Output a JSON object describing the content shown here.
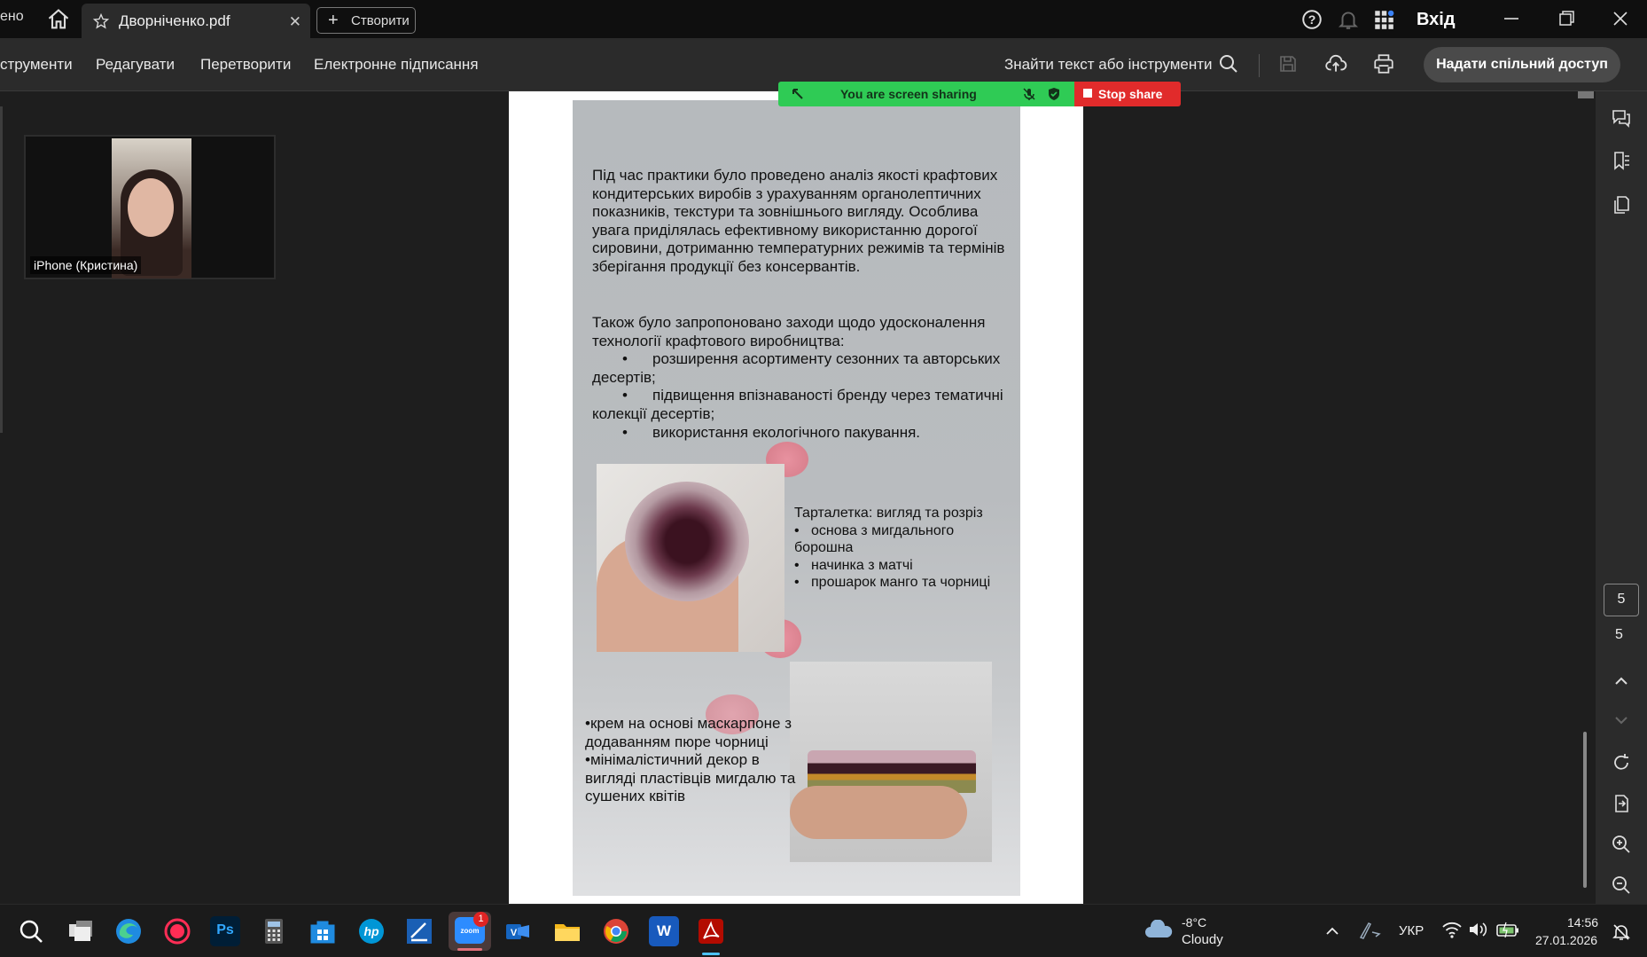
{
  "titlebar": {
    "left_cut_tab": "ено",
    "active_tab": "Дворніченко.pdf",
    "tab_close": "✕",
    "create_label": "Створити",
    "sign_in": "Вхід"
  },
  "toolbar": {
    "menu": [
      "струменти",
      "Редагувати",
      "Перетворити",
      "Електронне підписання"
    ],
    "find_placeholder": "Знайти текст або інструменти",
    "share_button": "Надати спільний доступ"
  },
  "video": {
    "participant": "iPhone (Кристина)"
  },
  "screen_share": {
    "status": "You are screen sharing",
    "stop": "Stop share"
  },
  "document": {
    "paragraph1": "Під час практики було проведено аналіз якості крафтових кондитерських виробів з урахуванням органолептичних показників, текстури та зовнішнього вигляду. Особлива увага приділялась ефективному використанню дорогої сировини, дотриманню температурних режимів та термінів зберігання продукції без консервантів.",
    "paragraph2_intro": "Також було запропоновано заходи щодо удосконалення технології крафтового виробництва:",
    "bullets": [
      "розширення асортименту сезонних та авторських десертів;",
      "підвищення впізнаваності бренду через тематичні колекції десертів;",
      "використання екологічного пакування."
    ],
    "caption1_title": "Тарталетка: вигляд та розріз",
    "caption1_items": [
      "основа з мигдального борошна",
      "начинка з матчі",
      "прошарок манго та чорниці"
    ],
    "caption2_items": [
      "крем на основі маскарпоне з додаванням пюре чорниці",
      "мінімалістичний декор в вигляді пластівців мигдалю та сушених квітів"
    ]
  },
  "pagination": {
    "current": "5",
    "total": "5"
  },
  "taskbar": {
    "zoom_badge": "1",
    "weather_temp": "-8°C",
    "weather_desc": "Cloudy",
    "language": "УКР",
    "time": "14:56",
    "date": "27.01.2026"
  },
  "colors": {
    "share_green": "#2fcb55",
    "stop_red": "#e12b2b",
    "toolbar_bg": "#2b2b2b"
  }
}
